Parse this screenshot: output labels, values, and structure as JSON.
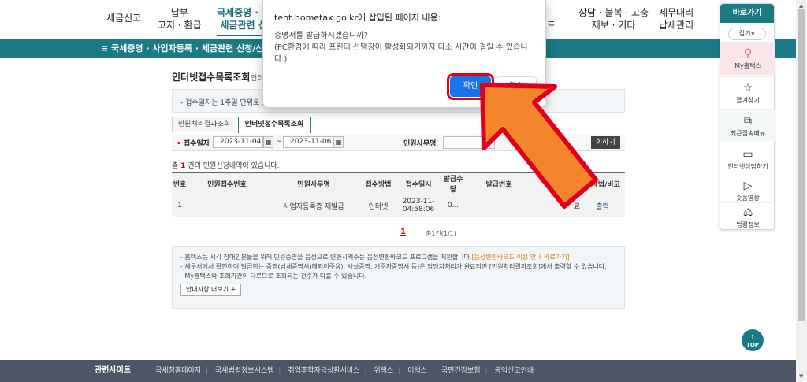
{
  "topnav": {
    "items": [
      {
        "line1": "세금신고",
        "line2": ""
      },
      {
        "line1": "납부",
        "line2": "고지 · 환급"
      },
      {
        "line1": "국세증명 · 사",
        "line2": "세금관련 신"
      },
      {
        "line1": "",
        "line2": "드"
      },
      {
        "line1": "상담 · 불복 · 고충",
        "line2": "제보 · 기타"
      },
      {
        "line1": "세무대리",
        "line2": "납세관리"
      }
    ]
  },
  "subbar": {
    "label": "≡  국세증명 · 사업자등록 · 세금관련 신청/신고"
  },
  "page": {
    "title": "인터넷접수목록조회",
    "title_sub": "인터",
    "notice": "- 접수일자는 1주일 단위로 조회",
    "tabs": [
      "민원처리결과조회",
      "인터넷접수목록조회"
    ],
    "search": {
      "date_label": "접수일자",
      "date_from": "2023-11-04",
      "date_to": "2023-11-06",
      "tilde": "~",
      "calendar_glyph": "▦",
      "type_label": "민원사무명",
      "button": "회하기"
    },
    "count_prefix": "총",
    "count_num": "1",
    "count_suffix": "건의 민원신청내역이 있습니다."
  },
  "table": {
    "headers": [
      "번호",
      "민원접수번호",
      "민원사무명",
      "접수방법",
      "접수일시",
      "발급수량",
      "발급번호",
      "",
      "명방법/비고"
    ],
    "rows": [
      [
        "1",
        "",
        "사업자등록증 재발급",
        "인터넷",
        "2023-11-\n04:58:06",
        "0...",
        "",
        "료",
        "출력"
      ]
    ]
  },
  "pager": {
    "current": "1",
    "total": "총1건(1/1)"
  },
  "guide": {
    "line1": "- 홈택스는 시각 장애인분들을 위해 민원증명을 음성으로 변환시켜주는 음성변환바코드 프로그램을 지원합니다.",
    "line1_link": "[음성변환바코드 이용 안내 바로가기]",
    "line2": "- 세무서에서 확인하여 발급하는 증명(납세증명서(해외이주용), 사실증명, 거주자증명서 등)은 담당자처리가 완료되면 [민원처리결과조회]에서 출력할 수 있습니다.",
    "line3": "- My홈택스와 조회기간이 다르므로 조회되는 건수가 다를 수 있습니다.",
    "button": "안내사항 더보기 +"
  },
  "quick": {
    "title": "바로가기",
    "fold": "접기∨",
    "items": [
      {
        "icon": "⚲",
        "label": "My홈택스"
      },
      {
        "icon": "☆",
        "label": "즐겨찾기"
      },
      {
        "icon": "⧉",
        "label": "최근접속메뉴"
      },
      {
        "icon": "▭",
        "label": "인터넷상담하기"
      },
      {
        "icon": "▷",
        "label": "숏폼영상"
      },
      {
        "icon": "⚖",
        "label": "법령정보"
      }
    ]
  },
  "top_button": {
    "arrow": "↑",
    "label": "TOP"
  },
  "scrollbar": {
    "up": "▲",
    "down": "▼"
  },
  "footer": {
    "title": "관련사이트",
    "links": [
      "국세청홈페이지",
      "국세법령정보시스템",
      "취업후학자금상환서비스",
      "위택스",
      "이택스",
      "국민건강보험",
      "공익신고안내"
    ],
    "divider": "|"
  },
  "dialog": {
    "title": "teht.hometax.go.kr에 삽입된 페이지 내용:",
    "message": "증명서를 발급하시겠습니까?\n(PC환경에 따라 프린터 선택창이 활성화되기까지 다소 시간이 걸릴 수 있습니다.)",
    "ok": "확인",
    "cancel": "취소"
  },
  "colors": {
    "teal": "#1b7a85",
    "annotation_arrow": "#f5852b",
    "annotation_outline": "#e0001b"
  }
}
